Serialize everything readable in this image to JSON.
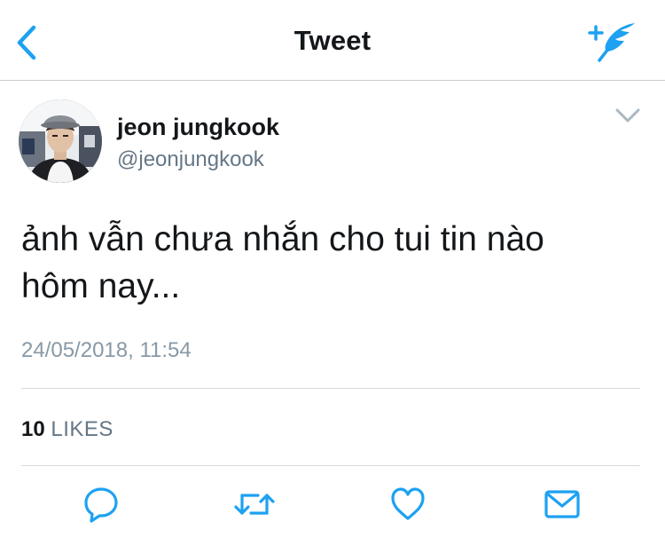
{
  "navbar": {
    "title": "Tweet",
    "back_icon": "chevron-left-icon",
    "compose_icon": "compose-tweet-icon",
    "accent_color": "#1da1f2"
  },
  "tweet": {
    "author": {
      "display_name": "jeon jungkook",
      "handle": "@jeonjungkook"
    },
    "text_lines": [
      "ảnh vẫn chưa nhắn cho tui tin nào",
      "hôm nay..."
    ],
    "timestamp": "24/05/2018, 11:54",
    "likes": {
      "count": "10",
      "label": "LIKES"
    }
  },
  "actions": [
    {
      "name": "reply",
      "icon": "reply-icon"
    },
    {
      "name": "retweet",
      "icon": "retweet-icon"
    },
    {
      "name": "like",
      "icon": "heart-icon"
    },
    {
      "name": "share",
      "icon": "mail-icon"
    }
  ],
  "colors": {
    "text_primary": "#14171a",
    "text_secondary": "#657786",
    "timestamp": "#8899a6",
    "divider": "#d5dade",
    "icon": "#1da1f2"
  }
}
